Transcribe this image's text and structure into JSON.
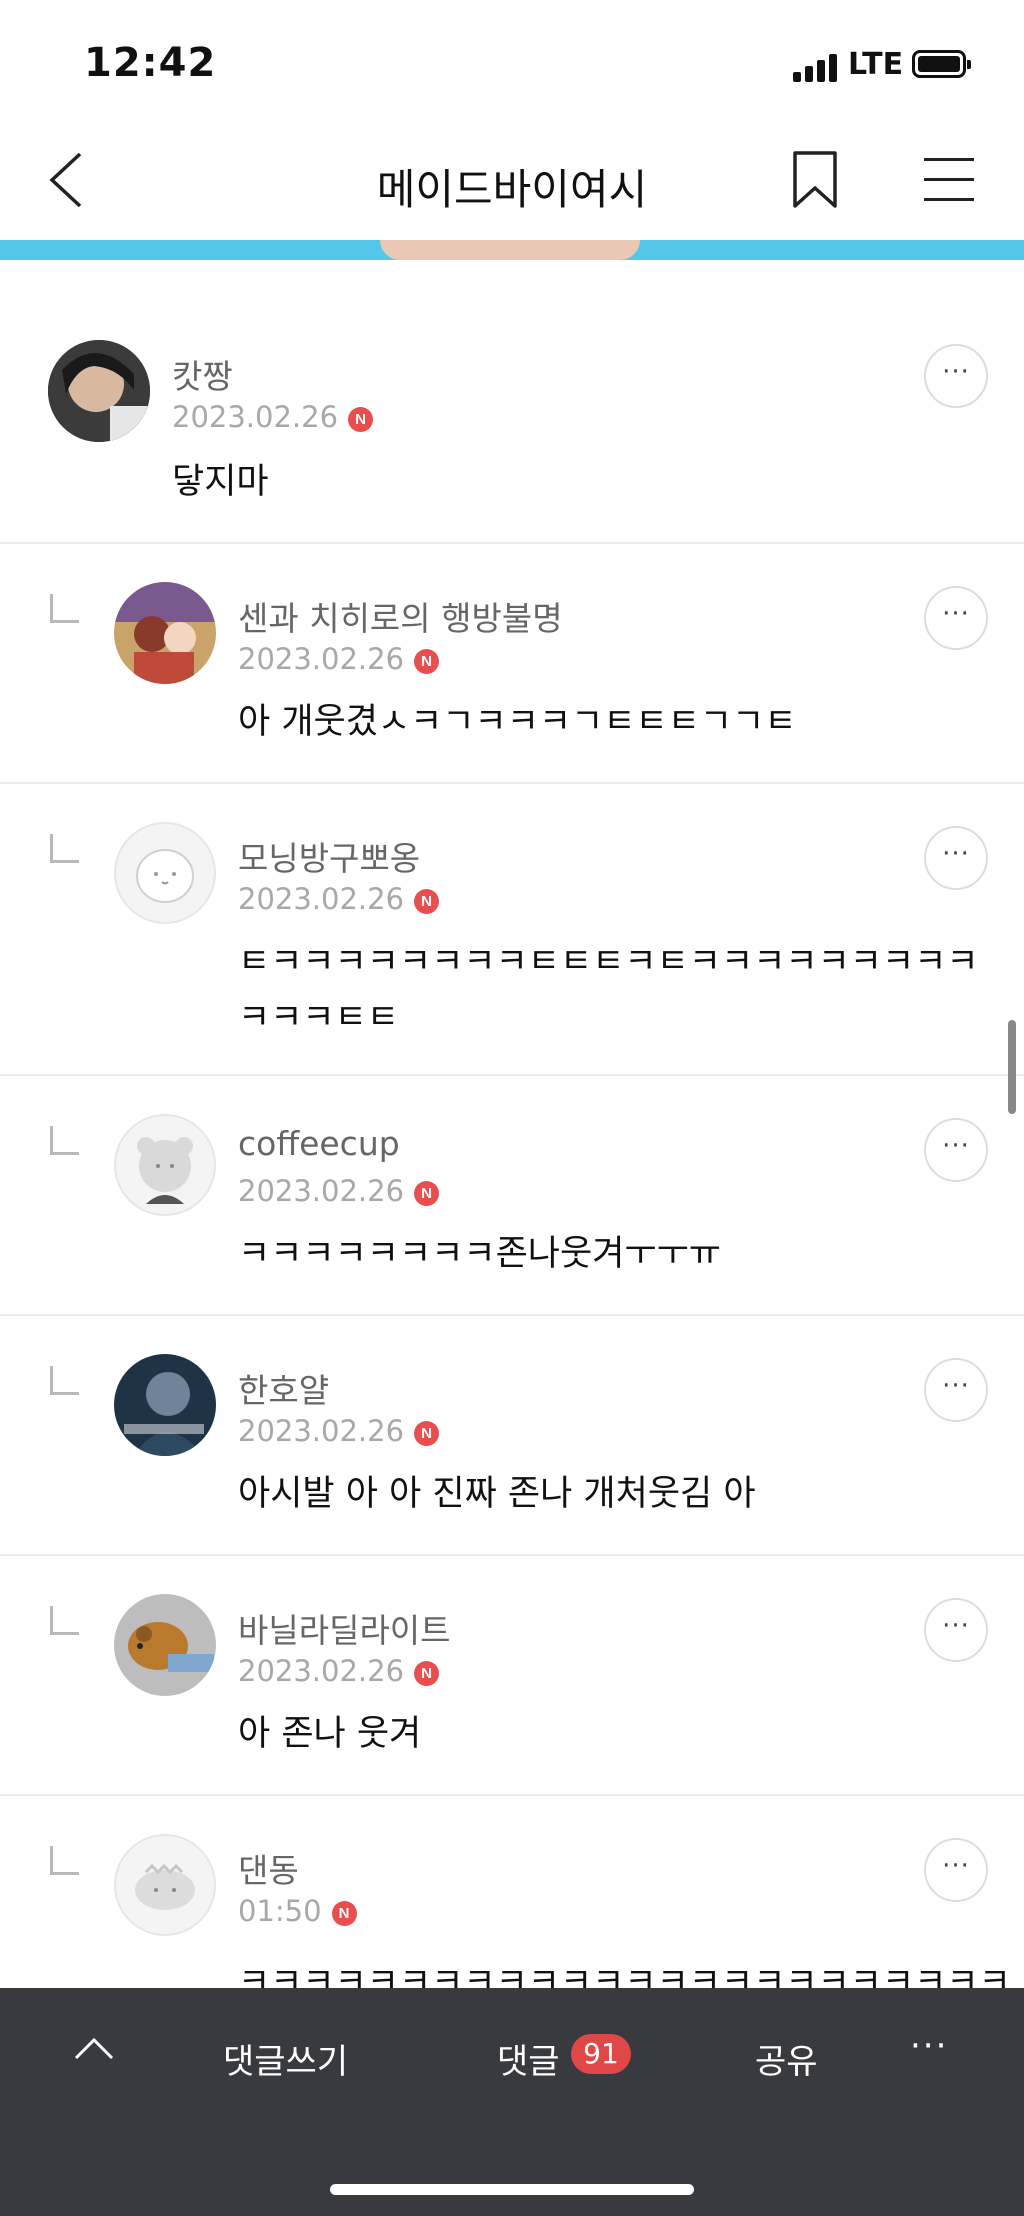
{
  "status_bar": {
    "time": "12:42",
    "network": "LTE"
  },
  "nav": {
    "title": "메이드바이여시"
  },
  "comments": [
    {
      "nickname": "캇짱",
      "date": "2023.02.26",
      "badge": "N",
      "text": "닿지마",
      "is_reply": false
    },
    {
      "nickname": "센과 치히로의 행방불명",
      "date": "2023.02.26",
      "badge": "N",
      "text": "아 개웃겼ㅅㅋㄱㅋㅋㅋㄱㅌㅌㅌㄱㄱㅌ",
      "is_reply": true
    },
    {
      "nickname": "모닝방구뽀옹",
      "date": "2023.02.26",
      "badge": "N",
      "text": "ㅌㅋㅋㅋㅋㅋㅋㅋㅋㅌㅌㅌㅋㅌㅋㅋㅋㅋㅋㅋㅋㅋㅋ",
      "text2": "ㅋㅋㅋㅌㅌ",
      "is_reply": true
    },
    {
      "nickname": "coffeecup",
      "date": "2023.02.26",
      "badge": "N",
      "text": "ㅋㅋㅋㅋㅋㅋㅋㅋ존나웃겨ㅜㅜㅠ",
      "is_reply": true
    },
    {
      "nickname": "한호얄",
      "date": "2023.02.26",
      "badge": "N",
      "text": "아시발 아 아 진짜 존나 개처웃김 아",
      "is_reply": true
    },
    {
      "nickname": "바닐라딜라이트",
      "date": "2023.02.26",
      "badge": "N",
      "text": "아 존나 웃겨",
      "is_reply": true
    },
    {
      "nickname": "댄동",
      "date": "01:50",
      "badge": "N",
      "text": "ㅋㅋㅋㅋㅋㅋㅋㅋㅋㅋㅋㅋㅋㅋㅋㅋㅋㅋㅋㅋㅋㅋㅋㅋ",
      "is_reply": true
    }
  ],
  "more_label": "···",
  "bottom_bar": {
    "write_label": "댓글쓰기",
    "comments_label": "댓글",
    "comment_count": "91",
    "share_label": "공유",
    "more_label": "···"
  },
  "colors": {
    "badge_red": "#e84e4e",
    "bottom_bar_bg": "#383a40",
    "banner_blue": "#55c8ea"
  }
}
